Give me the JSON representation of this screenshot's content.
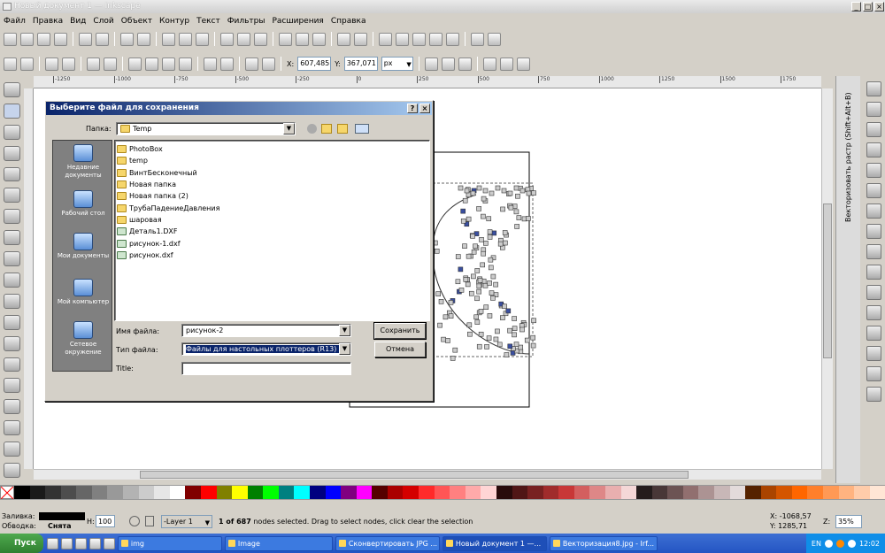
{
  "window": {
    "title": "Новый документ 1 — Inkscape"
  },
  "menu": [
    "Файл",
    "Правка",
    "Вид",
    "Слой",
    "Объект",
    "Контур",
    "Текст",
    "Фильтры",
    "Расширения",
    "Справка"
  ],
  "toolbar": {
    "x_label": "X:",
    "x_value": "607,485",
    "y_label": "Y:",
    "y_value": "367,071",
    "unit": "px"
  },
  "ruler": {
    "ticks": [
      "-1250",
      "-1000",
      "-750",
      "-500",
      "-250",
      "0",
      "250",
      "500",
      "750",
      "1000",
      "1250",
      "1500",
      "1750"
    ]
  },
  "right_dock": {
    "label": "Векторизовать растр (Shift+Alt+B)"
  },
  "dialog": {
    "title": "Выберите файл для сохранения",
    "folder_label": "Папка:",
    "folder_value": "Temp",
    "places": [
      {
        "label": "Недавние документы"
      },
      {
        "label": "Рабочий стол"
      },
      {
        "label": "Мои документы"
      },
      {
        "label": "Мой компьютер"
      },
      {
        "label": "Сетевое окружение"
      }
    ],
    "files": [
      {
        "name": "PhotoBox",
        "type": "folder"
      },
      {
        "name": "temp",
        "type": "folder"
      },
      {
        "name": "ВинтБесконечный",
        "type": "folder"
      },
      {
        "name": "Новая папка",
        "type": "folder"
      },
      {
        "name": "Новая папка (2)",
        "type": "folder"
      },
      {
        "name": "ТрубаПадениеДавления",
        "type": "folder"
      },
      {
        "name": "шаровая",
        "type": "folder"
      },
      {
        "name": "Деталь1.DXF",
        "type": "dxf"
      },
      {
        "name": "рисунок-1.dxf",
        "type": "dxf"
      },
      {
        "name": "рисунок.dxf",
        "type": "dxf"
      }
    ],
    "filename_label": "Имя файла:",
    "filename_value": "рисунок-2",
    "filetype_label": "Тип файла:",
    "filetype_value": "Файлы для настольных плоттеров (R13) (*.dxf)",
    "title_label": "Title:",
    "title_value": "",
    "save_button": "Сохранить",
    "cancel_button": "Отмена"
  },
  "status": {
    "fill_label": "Заливка:",
    "stroke_label": "Обводка:",
    "stroke_value": "Снята",
    "h_label": "H:",
    "h_value": "100",
    "layer": "-Layer 1",
    "message_bold": "1 of 687",
    "message_rest": " nodes selected. Drag to select nodes, click clear the selection",
    "x_coord": "X: -1068,57",
    "y_coord": "Y: 1285,71",
    "zoom_label": "Z:",
    "zoom_value": "35%"
  },
  "palette": [
    "#000000",
    "#1a1a1a",
    "#333333",
    "#4d4d4d",
    "#666666",
    "#808080",
    "#999999",
    "#b3b3b3",
    "#cccccc",
    "#e6e6e6",
    "#ffffff",
    "#800000",
    "#ff0000",
    "#808000",
    "#ffff00",
    "#008000",
    "#00ff00",
    "#008080",
    "#00ffff",
    "#000080",
    "#0000ff",
    "#800080",
    "#ff00ff",
    "#550000",
    "#aa0000",
    "#d40000",
    "#ff2a2a",
    "#ff5555",
    "#ff8080",
    "#ffaaaa",
    "#ffd5d5",
    "#280b0b",
    "#501616",
    "#782121",
    "#a02c2c",
    "#c83737",
    "#d35f5f",
    "#de8787",
    "#e9afaf",
    "#f4d7d7",
    "#241c1c",
    "#483737",
    "#6c5353",
    "#916f6f",
    "#ac9393",
    "#c8b7b7",
    "#e3dbdb",
    "#552200",
    "#aa4400",
    "#d45500",
    "#ff6600",
    "#ff7f2a",
    "#ff9955",
    "#ffb380",
    "#ffccaa",
    "#ffe6d5"
  ],
  "taskbar": {
    "start": "Пуск",
    "tasks": [
      "img",
      "Image",
      "Сконвертировать JPG ...",
      "Новый документ 1 —...",
      "Векторизация8.jpg - Irf..."
    ],
    "lang": "EN",
    "clock": "12:02"
  }
}
